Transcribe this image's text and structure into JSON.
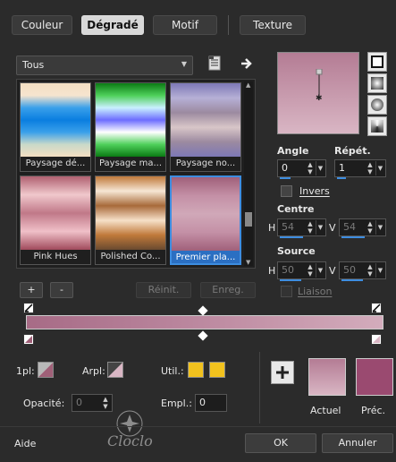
{
  "tabs": [
    "Couleur",
    "Dégradé",
    "Motif",
    "Texture"
  ],
  "active_tab": "Dégradé",
  "category": {
    "selected": "Tous"
  },
  "gradients": [
    {
      "name": "Paysage dé...",
      "stops": [
        "#f4dfc2",
        "#f6e4cf",
        "#3aa0ea",
        "#0a7ee0",
        "#3aa0ea",
        "#c9d9c9",
        "#f4dfc2"
      ]
    },
    {
      "name": "Paysage ma...",
      "stops": [
        "#0b7a14",
        "#4fd05b",
        "#c9f0ff",
        "#6d6dff",
        "#ffffff",
        "#4fd05b",
        "#0b7a14"
      ]
    },
    {
      "name": "Paysage no...",
      "stops": [
        "#7d78b6",
        "#b6b0d6",
        "#9c8aa0",
        "#d8c6c8",
        "#9c8aa0",
        "#7d78b6"
      ]
    },
    {
      "name": "Pink Hues",
      "stops": [
        "#b06070",
        "#f0c8cc",
        "#c07888",
        "#f0c0c8",
        "#a04a5c"
      ]
    },
    {
      "name": "Polished Co...",
      "stops": [
        "#c0793a",
        "#f6e6d4",
        "#a86a3a",
        "#f6e0c8",
        "#c0793a",
        "#6a4a30"
      ]
    },
    {
      "name": "Premier pla...",
      "stops": [
        "#a0607a",
        "#c490a6",
        "#d0a8b8",
        "#c490a6",
        "#a0607a"
      ]
    }
  ],
  "buttons": {
    "add": "+",
    "remove": "-",
    "reset": "Réinit.",
    "save": "Enreg.",
    "help": "Aide",
    "ok": "OK",
    "cancel": "Annuler"
  },
  "fields": {
    "angle_label": "Angle",
    "angle_value": "0",
    "repeat_label": "Répét.",
    "repeat_value": "1",
    "invert_label": "Invers",
    "center_label": "Centre",
    "center_h_label": "H",
    "center_h_value": "54",
    "center_v_label": "V",
    "center_v_value": "54",
    "source_label": "Source",
    "source_h_label": "H",
    "source_h_value": "50",
    "source_v_label": "V",
    "source_v_value": "50",
    "link_label": "Liaison",
    "fg_label": "1pl:",
    "bg_label": "Arpl:",
    "user_label": "Util.:",
    "opacity_label": "Opacité:",
    "opacity_value": "0",
    "location_label": "Empl.:",
    "location_value": "0"
  },
  "preview": {
    "current_label": "Actuel",
    "previous_label": "Préc."
  },
  "watermark": "Cloclo",
  "colors": {
    "background": "#2b2b2b",
    "accent": "#3d8de0",
    "gradient_top": "#b47c94",
    "gradient_bottom": "#d9b6c4",
    "previous_swatch": "#9a4a70",
    "user_swatch": "#f2c21e"
  },
  "icons": {
    "file": "file-icon",
    "arrow": "arrow-right-icon",
    "plus": "plus-icon"
  }
}
